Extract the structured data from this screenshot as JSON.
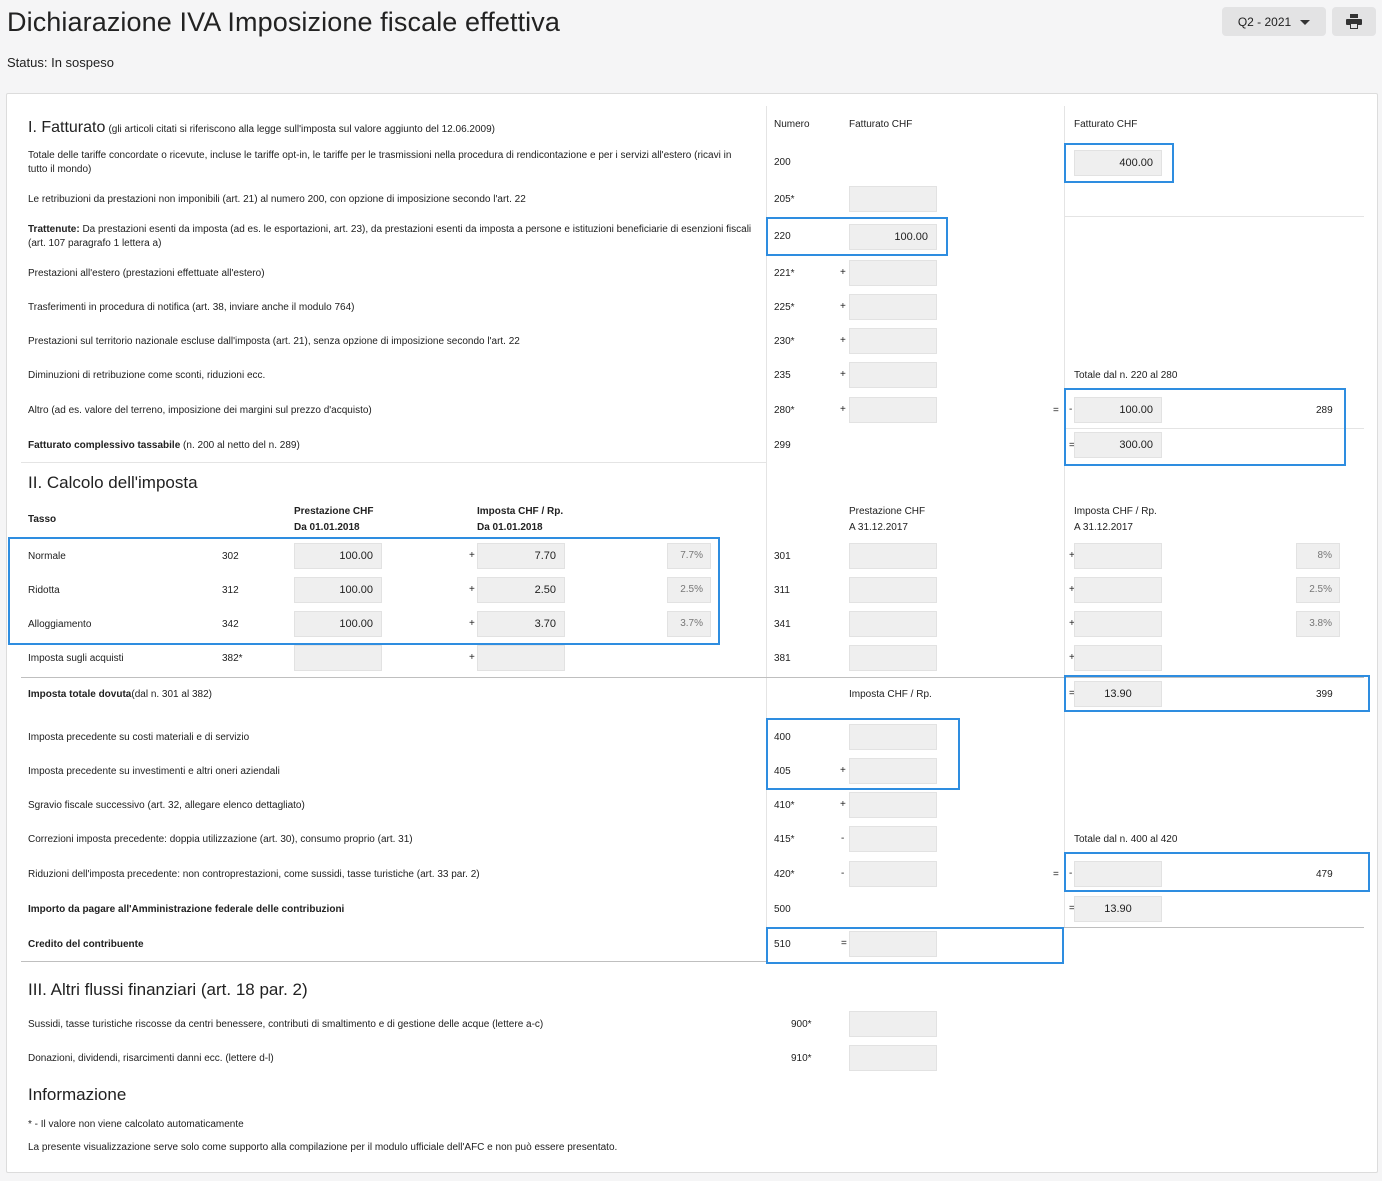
{
  "header": {
    "title": "Dichiarazione IVA Imposizione fiscale effettiva",
    "status_label": "Status: In sospeso",
    "period": "Q2 - 2021"
  },
  "icons": {
    "print": "print-icon",
    "dropdown": "caret-down-icon"
  },
  "colors": {
    "highlight": "#2e8de0",
    "input_bg": "#efefef"
  },
  "s1": {
    "title": "I. Fatturato",
    "subtitle": "(gli articoli citati si riferiscono alla legge sull'imposta sul valore aggiunto del 12.06.2009)",
    "col_numero": "Numero",
    "col_fatturato": "Fatturato CHF",
    "col_fatturato2": "Fatturato CHF",
    "r200_text": "Totale delle tariffe concordate o ricevute, incluse le tariffe opt-in, le tariffe per le trasmissioni nella procedura di rendicontazione e per i servizi all'estero (ricavi in tutto il mondo)",
    "r200_num": "200",
    "r200_val": "400.00",
    "r205_text": "Le retribuzioni da prestazioni non imponibili (art. 21) al numero 200, con opzione di imposizione secondo l'art. 22",
    "r205_num": "205*",
    "r220_bold": "Trattenute:",
    "r220_text": " Da prestazioni esenti da imposta (ad es. le esportazioni, art. 23), da prestazioni esenti da imposta a persone e istituzioni beneficiarie di esenzioni fiscali (art. 107 paragrafo 1 lettera a)",
    "r220_num": "220",
    "r220_val": "100.00",
    "r221_text": "Prestazioni all'estero (prestazioni effettuate all'estero)",
    "r221_num": "221*",
    "r225_text": "Trasferimenti in procedura di notifica (art. 38, inviare anche il modulo 764)",
    "r225_num": "225*",
    "r230_text": "Prestazioni sul territorio nazionale escluse dall'imposta (art. 21), senza opzione di imposizione secondo l'art. 22",
    "r230_num": "230*",
    "r235_text": "Diminuzioni di retribuzione come sconti, riduzioni ecc.",
    "r235_num": "235",
    "totale_220_280": "Totale dal n. 220 al 280",
    "r280_text": "Altro (ad es. valore del terreno, imposizione dei margini sul prezzo d'acquisto)",
    "r280_num": "280*",
    "r289_val": "100.00",
    "r289_num": "289",
    "r299_bold": "Fatturato complessivo tassabile",
    "r299_text": " (n. 200 al netto del n. 289)",
    "r299_num": "299",
    "r299_val": "300.00",
    "plus": "+",
    "minus": "-",
    "equals": "="
  },
  "s2": {
    "title": "II. Calcolo dell'imposta",
    "tasso": "Tasso",
    "prest_new_1": "Prestazione CHF",
    "prest_new_2": "Da 01.01.2018",
    "imp_new_1": "Imposta CHF / Rp.",
    "imp_new_2": "Da 01.01.2018",
    "prest_old_1": "Prestazione CHF",
    "prest_old_2": "A 31.12.2017",
    "imp_old_1": "Imposta CHF / Rp.",
    "imp_old_2": "A 31.12.2017",
    "rates": [
      {
        "label": "Normale",
        "num": "302",
        "prest": "100.00",
        "imp": "7.70",
        "pct": "7.7%",
        "old_num": "301",
        "old_pct": "8%"
      },
      {
        "label": "Ridotta",
        "num": "312",
        "prest": "100.00",
        "imp": "2.50",
        "pct": "2.5%",
        "old_num": "311",
        "old_pct": "2.5%"
      },
      {
        "label": "Alloggiamento",
        "num": "342",
        "prest": "100.00",
        "imp": "3.70",
        "pct": "3.7%",
        "old_num": "341",
        "old_pct": "3.8%"
      }
    ],
    "acq_label": "Imposta sugli acquisti",
    "acq_num": "382*",
    "acq_old_num": "381",
    "totale_bold": "Imposta totale dovuta",
    "totale_text": "(dal n. 301 al 382)",
    "totale_col": "Imposta CHF / Rp.",
    "r399_val": "13.90",
    "r399_num": "399",
    "r400_text": "Imposta precedente su costi materiali e di servizio",
    "r400_num": "400",
    "r405_text": "Imposta precedente su investimenti e altri oneri aziendali",
    "r405_num": "405",
    "r410_text": "Sgravio fiscale successivo (art. 32, allegare elenco dettagliato)",
    "r410_num": "410*",
    "r415_text": "Correzioni imposta precedente: doppia utilizzazione (art. 30), consumo proprio (art. 31)",
    "r415_num": "415*",
    "totale_400_420": "Totale dal n. 400 al 420",
    "r420_text": "Riduzioni dell'imposta precedente: non controprestazioni, come sussidi, tasse turistiche (art. 33 par. 2)",
    "r420_num": "420*",
    "r479_num": "479",
    "r500_text": "Importo da pagare all'Amministrazione federale delle contribuzioni",
    "r500_num": "500",
    "r500_val": "13.90",
    "r510_text": "Credito del contribuente",
    "r510_num": "510"
  },
  "s3": {
    "title": "III. Altri flussi finanziari (art. 18 par. 2)",
    "r900_text": "Sussidi, tasse turistiche riscosse da centri benessere, contributi di smaltimento e di gestione delle acque (lettere a-c)",
    "r900_num": "900*",
    "r910_text": "Donazioni, dividendi, risarcimenti danni ecc. (lettere d-l)",
    "r910_num": "910*"
  },
  "info": {
    "title": "Informazione",
    "note1": "* - Il valore non viene calcolato automaticamente",
    "note2": "La presente visualizzazione serve solo come supporto alla compilazione per il modulo ufficiale dell'AFC e non può essere presentato."
  }
}
